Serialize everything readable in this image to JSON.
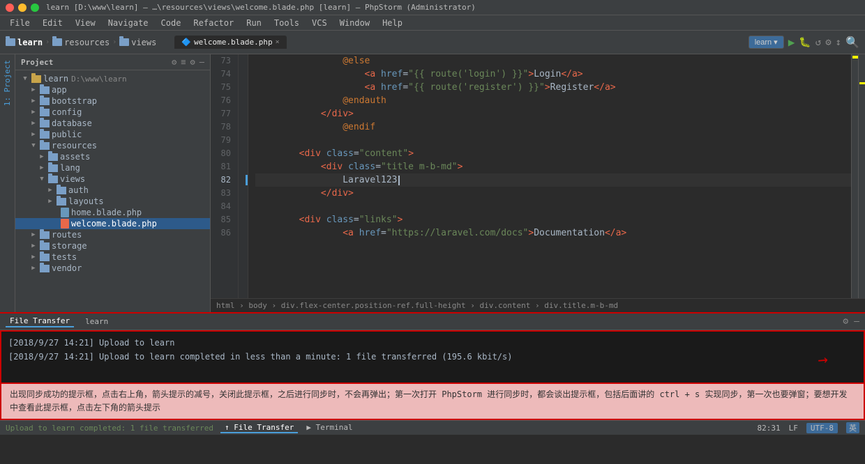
{
  "window": {
    "title": "learn [D:\\www\\learn] – …\\resources\\views\\welcome.blade.php [learn] – PhpStorm (Administrator)",
    "title_short": "learn [D:\\www\\learn] – …\\resources\\views\\welcome.blade.php [learn] – PhpStorm (Administrator)"
  },
  "menu": {
    "items": [
      "File",
      "Edit",
      "View",
      "Navigate",
      "Code",
      "Refactor",
      "Run",
      "Tools",
      "VCS",
      "Window",
      "Help"
    ]
  },
  "toolbar": {
    "breadcrumb": [
      "learn",
      "resources",
      "views"
    ],
    "tab_label": "welcome.blade.php",
    "project_button": "learn",
    "project_dropdown": "▾"
  },
  "sidebar": {
    "header_title": "Project",
    "header_icons": [
      "⚙",
      "≡",
      "⚙",
      "—"
    ],
    "tree": [
      {
        "level": 0,
        "type": "folder",
        "color": "yellow",
        "label": "learn",
        "path": "D:\\www\\learn",
        "open": true,
        "arrow": "▼"
      },
      {
        "level": 1,
        "type": "folder",
        "color": "blue",
        "label": "app",
        "open": false,
        "arrow": "▶"
      },
      {
        "level": 1,
        "type": "folder",
        "color": "blue",
        "label": "bootstrap",
        "open": false,
        "arrow": "▶"
      },
      {
        "level": 1,
        "type": "folder",
        "color": "blue",
        "label": "config",
        "open": false,
        "arrow": "▶"
      },
      {
        "level": 1,
        "type": "folder",
        "color": "blue",
        "label": "database",
        "open": false,
        "arrow": "▶"
      },
      {
        "level": 1,
        "type": "folder",
        "color": "blue",
        "label": "public",
        "open": false,
        "arrow": "▶"
      },
      {
        "level": 1,
        "type": "folder",
        "color": "blue",
        "label": "resources",
        "open": true,
        "arrow": "▼"
      },
      {
        "level": 2,
        "type": "folder",
        "color": "blue",
        "label": "assets",
        "open": false,
        "arrow": "▶"
      },
      {
        "level": 2,
        "type": "folder",
        "color": "blue",
        "label": "lang",
        "open": false,
        "arrow": "▶"
      },
      {
        "level": 2,
        "type": "folder",
        "color": "blue",
        "label": "views",
        "open": true,
        "arrow": "▼"
      },
      {
        "level": 3,
        "type": "folder",
        "color": "blue",
        "label": "auth",
        "open": false,
        "arrow": "▶"
      },
      {
        "level": 3,
        "type": "folder",
        "color": "blue",
        "label": "layouts",
        "open": false,
        "arrow": "▶"
      },
      {
        "level": 3,
        "type": "file",
        "color": "php",
        "label": "home.blade.php"
      },
      {
        "level": 3,
        "type": "file",
        "color": "blade-php",
        "label": "welcome.blade.php",
        "selected": true
      },
      {
        "level": 1,
        "type": "folder",
        "color": "blue",
        "label": "routes",
        "open": false,
        "arrow": "▶"
      },
      {
        "level": 1,
        "type": "folder",
        "color": "blue",
        "label": "storage",
        "open": false,
        "arrow": "▶"
      },
      {
        "level": 1,
        "type": "folder",
        "color": "blue",
        "label": "tests",
        "open": false,
        "arrow": "▶"
      },
      {
        "level": 1,
        "type": "folder",
        "color": "blue",
        "label": "vendor",
        "open": false,
        "arrow": "▶"
      }
    ]
  },
  "editor": {
    "filename": "welcome.blade.php",
    "lines": [
      {
        "num": 73,
        "content": "                @else",
        "type": "blade"
      },
      {
        "num": 74,
        "content": "                    <a href=\"{{ route('login') }}\">Login</a>",
        "type": "html"
      },
      {
        "num": 75,
        "content": "                    <a href=\"{{ route('register') }}\">Register</a>",
        "type": "html"
      },
      {
        "num": 76,
        "content": "                @endauth",
        "type": "blade"
      },
      {
        "num": 77,
        "content": "            </div>",
        "type": "html"
      },
      {
        "num": 78,
        "content": "                @endif",
        "type": "blade"
      },
      {
        "num": 79,
        "content": "",
        "type": "empty"
      },
      {
        "num": 80,
        "content": "        <div class=\"content\">",
        "type": "html"
      },
      {
        "num": 81,
        "content": "            <div class=\"title m-b-md\">",
        "type": "html"
      },
      {
        "num": 82,
        "content": "                Laravel123",
        "type": "text",
        "cursor": true
      },
      {
        "num": 83,
        "content": "            </div>",
        "type": "html"
      },
      {
        "num": 84,
        "content": "",
        "type": "empty"
      },
      {
        "num": 85,
        "content": "        <div class=\"links\">",
        "type": "html"
      },
      {
        "num": 86,
        "content": "                <a href=\"https://laravel.com/docs\">Documentation</a>",
        "type": "html"
      }
    ],
    "path_bar": "html › body › div.flex-center.position-ref.full-height › div.content › div.title.m-b-md"
  },
  "bottom_panel": {
    "tabs": [
      "File Transfer",
      "learn"
    ],
    "active_tab": "File Transfer",
    "log_lines": [
      "[2018/9/27 14:21] Upload to learn",
      "[2018/9/27 14:21] Upload to learn completed in less than a minute: 1 file transferred (195.6 kbit/s)"
    ]
  },
  "annotation": {
    "text": "出现同步成功的提示框，点击右上角，箭头提示的减号，关闭此提示框，之后进行同步时，不会再弹出；第一次打开 PhpStorm 进行同步时，都会谈出提示框，包括后面讲的 ctrl + s 实现同步，第一次也要弹窗；要想开发中查看此提示框，点击左下角的箭头提示"
  },
  "status_bar": {
    "upload_text": "Upload to learn completed: 1 file transferred",
    "tabs": [
      "File Transfer",
      "Terminal"
    ],
    "active_tab": "File Transfer",
    "position": "82:31",
    "line_ending": "LF",
    "encoding": "UTF-8",
    "lang": "英"
  }
}
